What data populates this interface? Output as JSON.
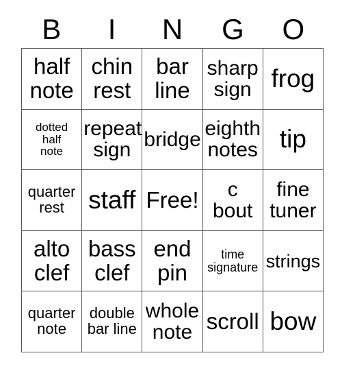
{
  "card": {
    "title": "BINGO",
    "headers": [
      "B",
      "I",
      "N",
      "G",
      "O"
    ],
    "free_space_label": "Free!",
    "colors": {
      "background": "#ffffff",
      "text": "#000000",
      "grid_line": "#555555"
    },
    "rows": [
      [
        {
          "text": "half\nnote",
          "size": "lg"
        },
        {
          "text": "chin\nrest",
          "size": "lg"
        },
        {
          "text": "bar\nline",
          "size": "lg"
        },
        {
          "text": "sharp\nsign",
          "size": "md"
        },
        {
          "text": "frog",
          "size": "xl"
        }
      ],
      [
        {
          "text": "dotted\nhalf\nnote",
          "size": "tiny"
        },
        {
          "text": "repeat\nsign",
          "size": "md"
        },
        {
          "text": "bridge",
          "size": "md"
        },
        {
          "text": "eighth\nnotes",
          "size": "md"
        },
        {
          "text": "tip",
          "size": "xl"
        }
      ],
      [
        {
          "text": "quarter\nrest",
          "size": "xs"
        },
        {
          "text": "staff",
          "size": "xl"
        },
        {
          "text": "Free!",
          "size": "lg"
        },
        {
          "text": "c\nbout",
          "size": "md"
        },
        {
          "text": "fine\ntuner",
          "size": "md"
        }
      ],
      [
        {
          "text": "alto\nclef",
          "size": "lg"
        },
        {
          "text": "bass\nclef",
          "size": "lg"
        },
        {
          "text": "end\npin",
          "size": "lg"
        },
        {
          "text": "time\nsignature",
          "size": "xxs"
        },
        {
          "text": "strings",
          "size": "sm"
        }
      ],
      [
        {
          "text": "quarter\nnote",
          "size": "xs"
        },
        {
          "text": "double\nbar line",
          "size": "xs"
        },
        {
          "text": "whole\nnote",
          "size": "md"
        },
        {
          "text": "scroll",
          "size": "lg"
        },
        {
          "text": "bow",
          "size": "xl"
        }
      ]
    ]
  }
}
